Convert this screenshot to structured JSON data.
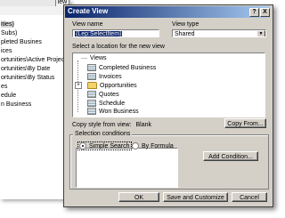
{
  "background": {
    "view_btn": "iew",
    "items": [
      "ities)",
      "Subs)",
      "pleted Busines",
      "ices",
      "ortunities\\Active Projects",
      "ortunities\\By Date",
      "ortunities\\By Status",
      "es",
      "edule",
      "n Business"
    ]
  },
  "dialog": {
    "title": "Create View",
    "help_btn": "?",
    "close_btn": "X",
    "view_name_label": "View name",
    "view_name_value": "{Lep:SelectItem}",
    "view_type_label": "View type",
    "view_type_value": "Shared",
    "location_label": "Select a location for the new view",
    "tree": {
      "root": "Views",
      "items": [
        "Completed Business",
        "Invoices",
        "Opportunities",
        "Quotes",
        "Schedule",
        "Won Business"
      ]
    },
    "copy_style_label": "Copy style from view:",
    "copy_style_value": "Blank",
    "copy_from_button": "Copy From...",
    "selection_conditions_label": "Selection conditions",
    "simple_search_label": "Simple Search",
    "by_formula_label": "By Formula",
    "add_condition_button": "Add Condition...",
    "ok_button": "OK",
    "save_customize_button": "Save and Customize",
    "cancel_button": "Cancel"
  },
  "colors": {
    "title_gradient_start": "#0a246a",
    "title_gradient_end": "#a6caf0",
    "dialog_face": "#d4d0c8"
  }
}
